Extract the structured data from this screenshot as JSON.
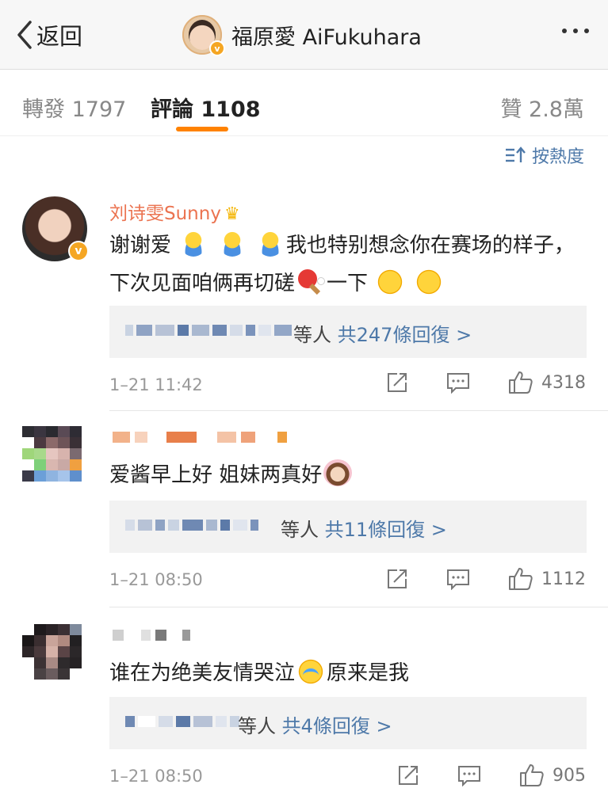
{
  "nav": {
    "back_label": "返回",
    "title": "福原愛 AiFukuhara",
    "verified_mark": "v"
  },
  "tabs": {
    "reposts": "轉發 1797",
    "comments": "評論 1108",
    "likes": "贊 2.8萬"
  },
  "sort": {
    "label": "按熱度"
  },
  "comments": [
    {
      "user": "刘诗雯Sunny",
      "text_a": "谢谢爱",
      "text_b": "我也特别想念你在赛场的样子，下次见面咱俩再切磋",
      "text_c": "一下",
      "replies_suffix": "等人",
      "replies_link": "共247條回復 >",
      "time": "1–21 11:42",
      "likes": "4318"
    },
    {
      "text_a": "爱酱早上好 姐妹两真好",
      "replies_suffix": "等人",
      "replies_link": "共11條回復 >",
      "time": "1–21 08:50",
      "likes": "1112"
    },
    {
      "text_a": "谁在为绝美友情哭泣",
      "text_b": "原来是我",
      "replies_suffix": "等人",
      "replies_link": "共4條回復 >",
      "time": "1–21 08:50",
      "likes": "905"
    }
  ],
  "colors": {
    "accent_orange": "#ff8200",
    "username_orange": "#eb7350",
    "link_blue": "#4e79a9",
    "reply_box_bg": "#f2f2f2"
  }
}
